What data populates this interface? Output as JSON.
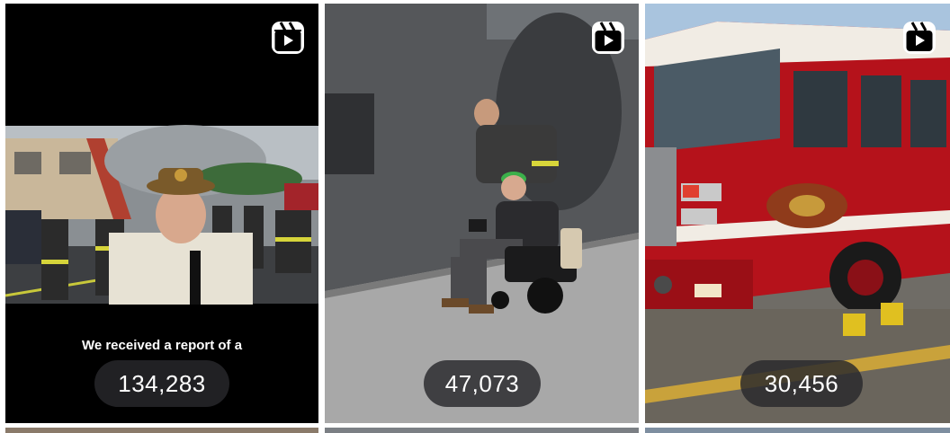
{
  "reels": [
    {
      "views": "134,283",
      "caption": "We received a report of a",
      "icon": "reels-icon"
    },
    {
      "views": "47,073",
      "icon": "reels-icon"
    },
    {
      "views": "30,456",
      "icon": "reels-icon"
    }
  ],
  "colors": {
    "pill_bg": "#28282c",
    "fire_red": "#b5121b",
    "icon_white": "#ffffff"
  }
}
